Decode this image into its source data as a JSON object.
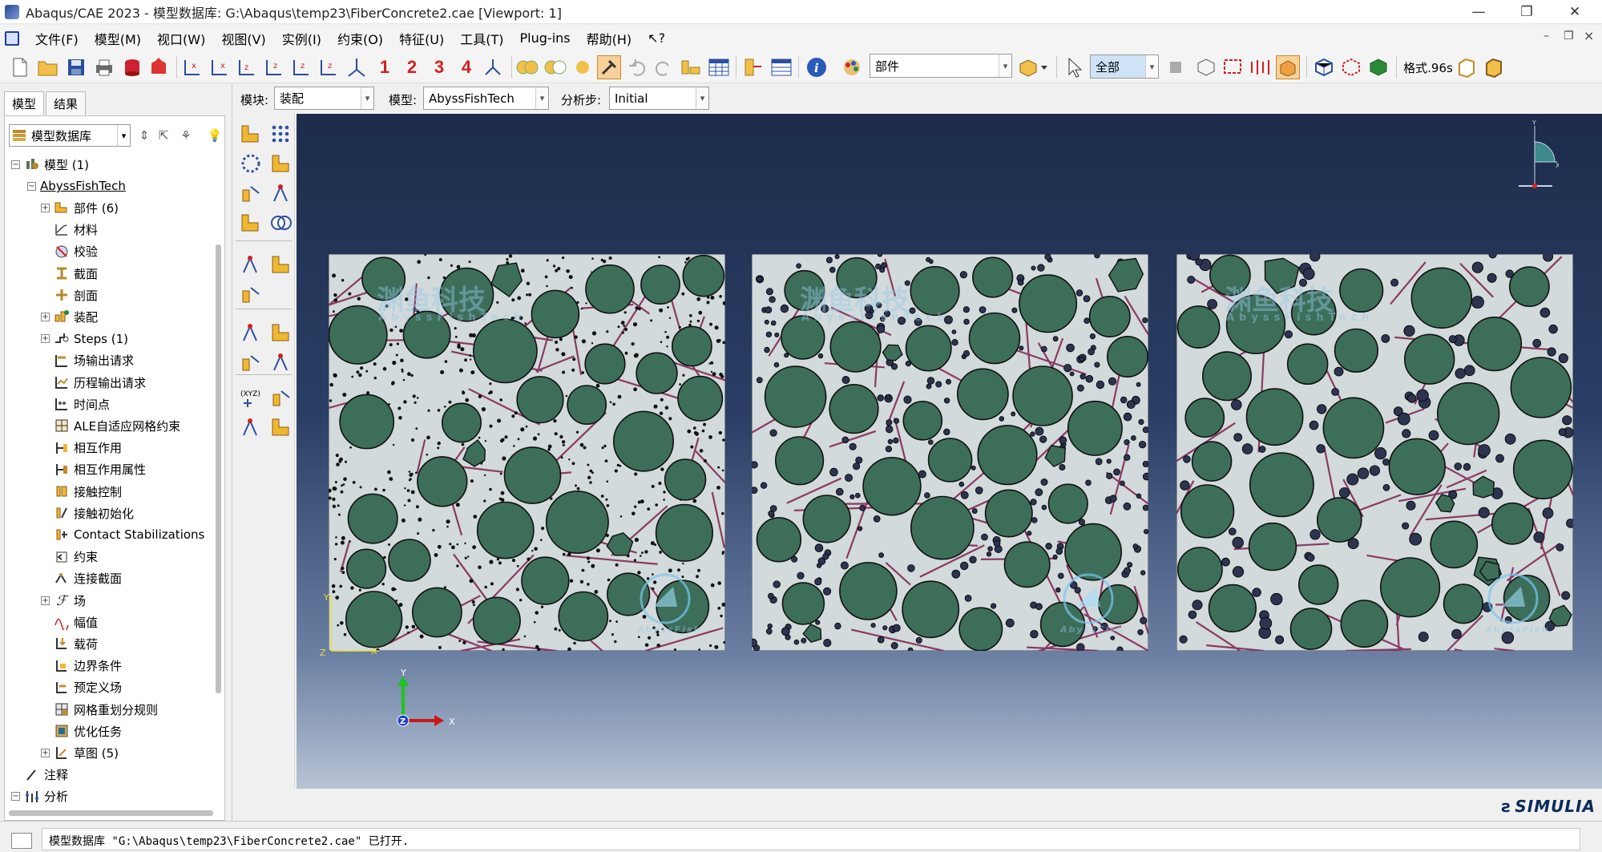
{
  "window": {
    "title": "Abaqus/CAE 2023 - 模型数据库: G:\\Abaqus\\temp23\\FiberConcrete2.cae [Viewport: 1]",
    "minimize": "—",
    "maximize": "❐",
    "close": "✕"
  },
  "menubar": {
    "items": [
      "文件(F)",
      "模型(M)",
      "视口(W)",
      "视图(V)",
      "实例(I)",
      "约束(O)",
      "特征(U)",
      "工具(T)",
      "Plug-ins",
      "帮助(H)",
      "↖?"
    ],
    "mdi_controls": [
      "–",
      "❐",
      "×"
    ]
  },
  "toolbar": {
    "view_numbers": [
      "1",
      "2",
      "3",
      "4"
    ],
    "part_combo": "部件",
    "select_combo": "全部",
    "format_label": "格式.96s"
  },
  "context": {
    "module_label": "模块:",
    "module_value": "装配",
    "model_label": "模型:",
    "model_value": "AbyssFishTech",
    "step_label": "分析步:",
    "step_value": "Initial"
  },
  "leftpanel": {
    "tabs": [
      "模型",
      "结果"
    ],
    "header_combo": "模型数据库"
  },
  "tree": [
    {
      "label": "模型 (1)",
      "level": 0,
      "exp": "−",
      "icon": "models-icon"
    },
    {
      "label": "AbyssFishTech",
      "level": 1,
      "exp": "−",
      "icon": "",
      "underline": true
    },
    {
      "label": "部件 (6)",
      "level": 2,
      "exp": "+",
      "icon": "parts-icon"
    },
    {
      "label": "材料",
      "level": 2,
      "exp": "",
      "icon": "materials-icon"
    },
    {
      "label": "校验",
      "level": 2,
      "exp": "",
      "icon": "calibration-icon"
    },
    {
      "label": "截面",
      "level": 2,
      "exp": "",
      "icon": "section-icon"
    },
    {
      "label": "剖面",
      "level": 2,
      "exp": "",
      "icon": "profile-icon"
    },
    {
      "label": "装配",
      "level": 2,
      "exp": "+",
      "icon": "assembly-icon"
    },
    {
      "label": "Steps (1)",
      "level": 2,
      "exp": "+",
      "icon": "steps-icon"
    },
    {
      "label": "场输出请求",
      "level": 2,
      "exp": "",
      "icon": "field-output-icon"
    },
    {
      "label": "历程输出请求",
      "level": 2,
      "exp": "",
      "icon": "history-output-icon"
    },
    {
      "label": "时间点",
      "level": 2,
      "exp": "",
      "icon": "time-points-icon"
    },
    {
      "label": "ALE自适应网格约束",
      "level": 2,
      "exp": "",
      "icon": "ale-icon"
    },
    {
      "label": "相互作用",
      "level": 2,
      "exp": "",
      "icon": "interaction-icon"
    },
    {
      "label": "相互作用属性",
      "level": 2,
      "exp": "",
      "icon": "interaction-property-icon"
    },
    {
      "label": "接触控制",
      "level": 2,
      "exp": "",
      "icon": "contact-control-icon"
    },
    {
      "label": "接触初始化",
      "level": 2,
      "exp": "",
      "icon": "contact-init-icon"
    },
    {
      "label": "Contact Stabilizations",
      "level": 2,
      "exp": "",
      "icon": "contact-stab-icon"
    },
    {
      "label": "约束",
      "level": 2,
      "exp": "",
      "icon": "constraint-icon"
    },
    {
      "label": "连接截面",
      "level": 2,
      "exp": "",
      "icon": "connector-section-icon"
    },
    {
      "label": "场",
      "level": 2,
      "exp": "+",
      "icon": "field-icon"
    },
    {
      "label": "幅值",
      "level": 2,
      "exp": "",
      "icon": "amplitude-icon"
    },
    {
      "label": "载荷",
      "level": 2,
      "exp": "",
      "icon": "load-icon"
    },
    {
      "label": "边界条件",
      "level": 2,
      "exp": "",
      "icon": "bc-icon"
    },
    {
      "label": "预定义场",
      "level": 2,
      "exp": "",
      "icon": "predefined-field-icon"
    },
    {
      "label": "网格重划分规则",
      "level": 2,
      "exp": "",
      "icon": "remesh-icon"
    },
    {
      "label": "优化任务",
      "level": 2,
      "exp": "",
      "icon": "optimization-icon"
    },
    {
      "label": "草图 (5)",
      "level": 2,
      "exp": "+",
      "icon": "sketch-icon"
    },
    {
      "label": "注释",
      "level": 0,
      "exp": "",
      "icon": "annotation-icon"
    },
    {
      "label": "分析",
      "level": 0,
      "exp": "−",
      "icon": "analysis-icon"
    }
  ],
  "viewport": {
    "watermark_cn": "渊鱼科技",
    "watermark_en": "AbyssFishTech",
    "logo_text": "AbyssFish",
    "triad": {
      "x": "X",
      "y": "Y",
      "z": "Z"
    },
    "colors": {
      "aggregate": "#3d6e5a",
      "matrix": "#d2dadb",
      "fiber": "#8a3a62",
      "particle": "#2c3450",
      "bg_top": "#1d2c4b",
      "bg_bottom": "#b8c3d5"
    }
  },
  "footer": {
    "brand": "SIMULIA"
  },
  "message": {
    "text": "模型数据库 \"G:\\Abaqus\\temp23\\FiberConcrete2.cae\" 已打开."
  }
}
